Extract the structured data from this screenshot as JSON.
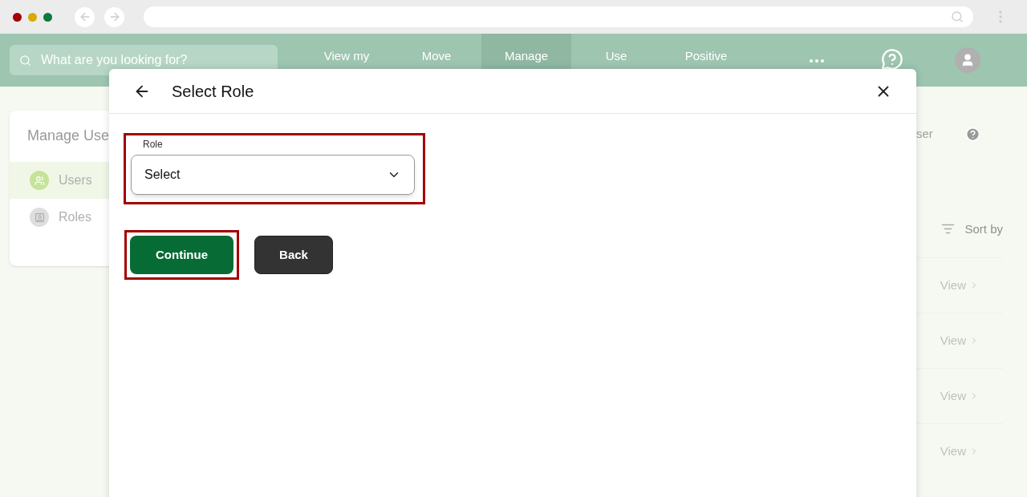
{
  "header": {
    "search": {
      "placeholder": "What are you looking for?"
    },
    "nav": [
      {
        "label": "View my",
        "selected": false
      },
      {
        "label": "Move",
        "selected": false
      },
      {
        "label": "Manage",
        "selected": true
      },
      {
        "label": "Use",
        "selected": false
      },
      {
        "label": "Positive",
        "selected": false
      }
    ]
  },
  "sidebar": {
    "title": "Manage Use",
    "items": [
      {
        "label": "Users",
        "selected": true
      },
      {
        "label": "Roles",
        "selected": false
      }
    ]
  },
  "content": {
    "add_button": "ser",
    "sort": "Sort by",
    "rows": [
      {
        "action": "View"
      },
      {
        "action": "View"
      },
      {
        "action": "View"
      },
      {
        "action": "View"
      }
    ]
  },
  "dialog": {
    "title": "Select Role",
    "field": {
      "label": "Role",
      "value": "Select",
      "highlighted": true
    },
    "buttons": [
      {
        "label": "Continue",
        "kind": "primary",
        "highlighted": true
      },
      {
        "label": "Back",
        "kind": "secondary",
        "highlighted": false
      }
    ]
  }
}
